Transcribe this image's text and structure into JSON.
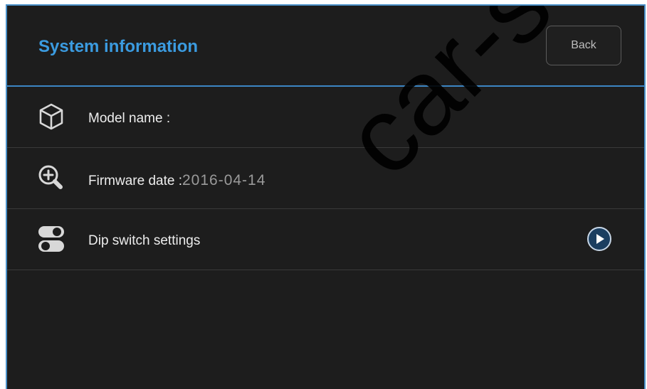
{
  "header": {
    "title": "System information",
    "back_label": "Back"
  },
  "rows": [
    {
      "label": "Model name :",
      "value": "",
      "icon": "cube-icon"
    },
    {
      "label": "Firmware date :",
      "value": "2016-04-14",
      "icon": "zoom-in-icon"
    },
    {
      "label": "Dip switch settings",
      "value": "",
      "icon": "toggle-switch-icon",
      "action_icon": "play-icon"
    }
  ],
  "watermark": "car-solu",
  "colors": {
    "accent": "#3b9be0",
    "background": "#1d1d1d",
    "divider": "#3a3a3a"
  }
}
